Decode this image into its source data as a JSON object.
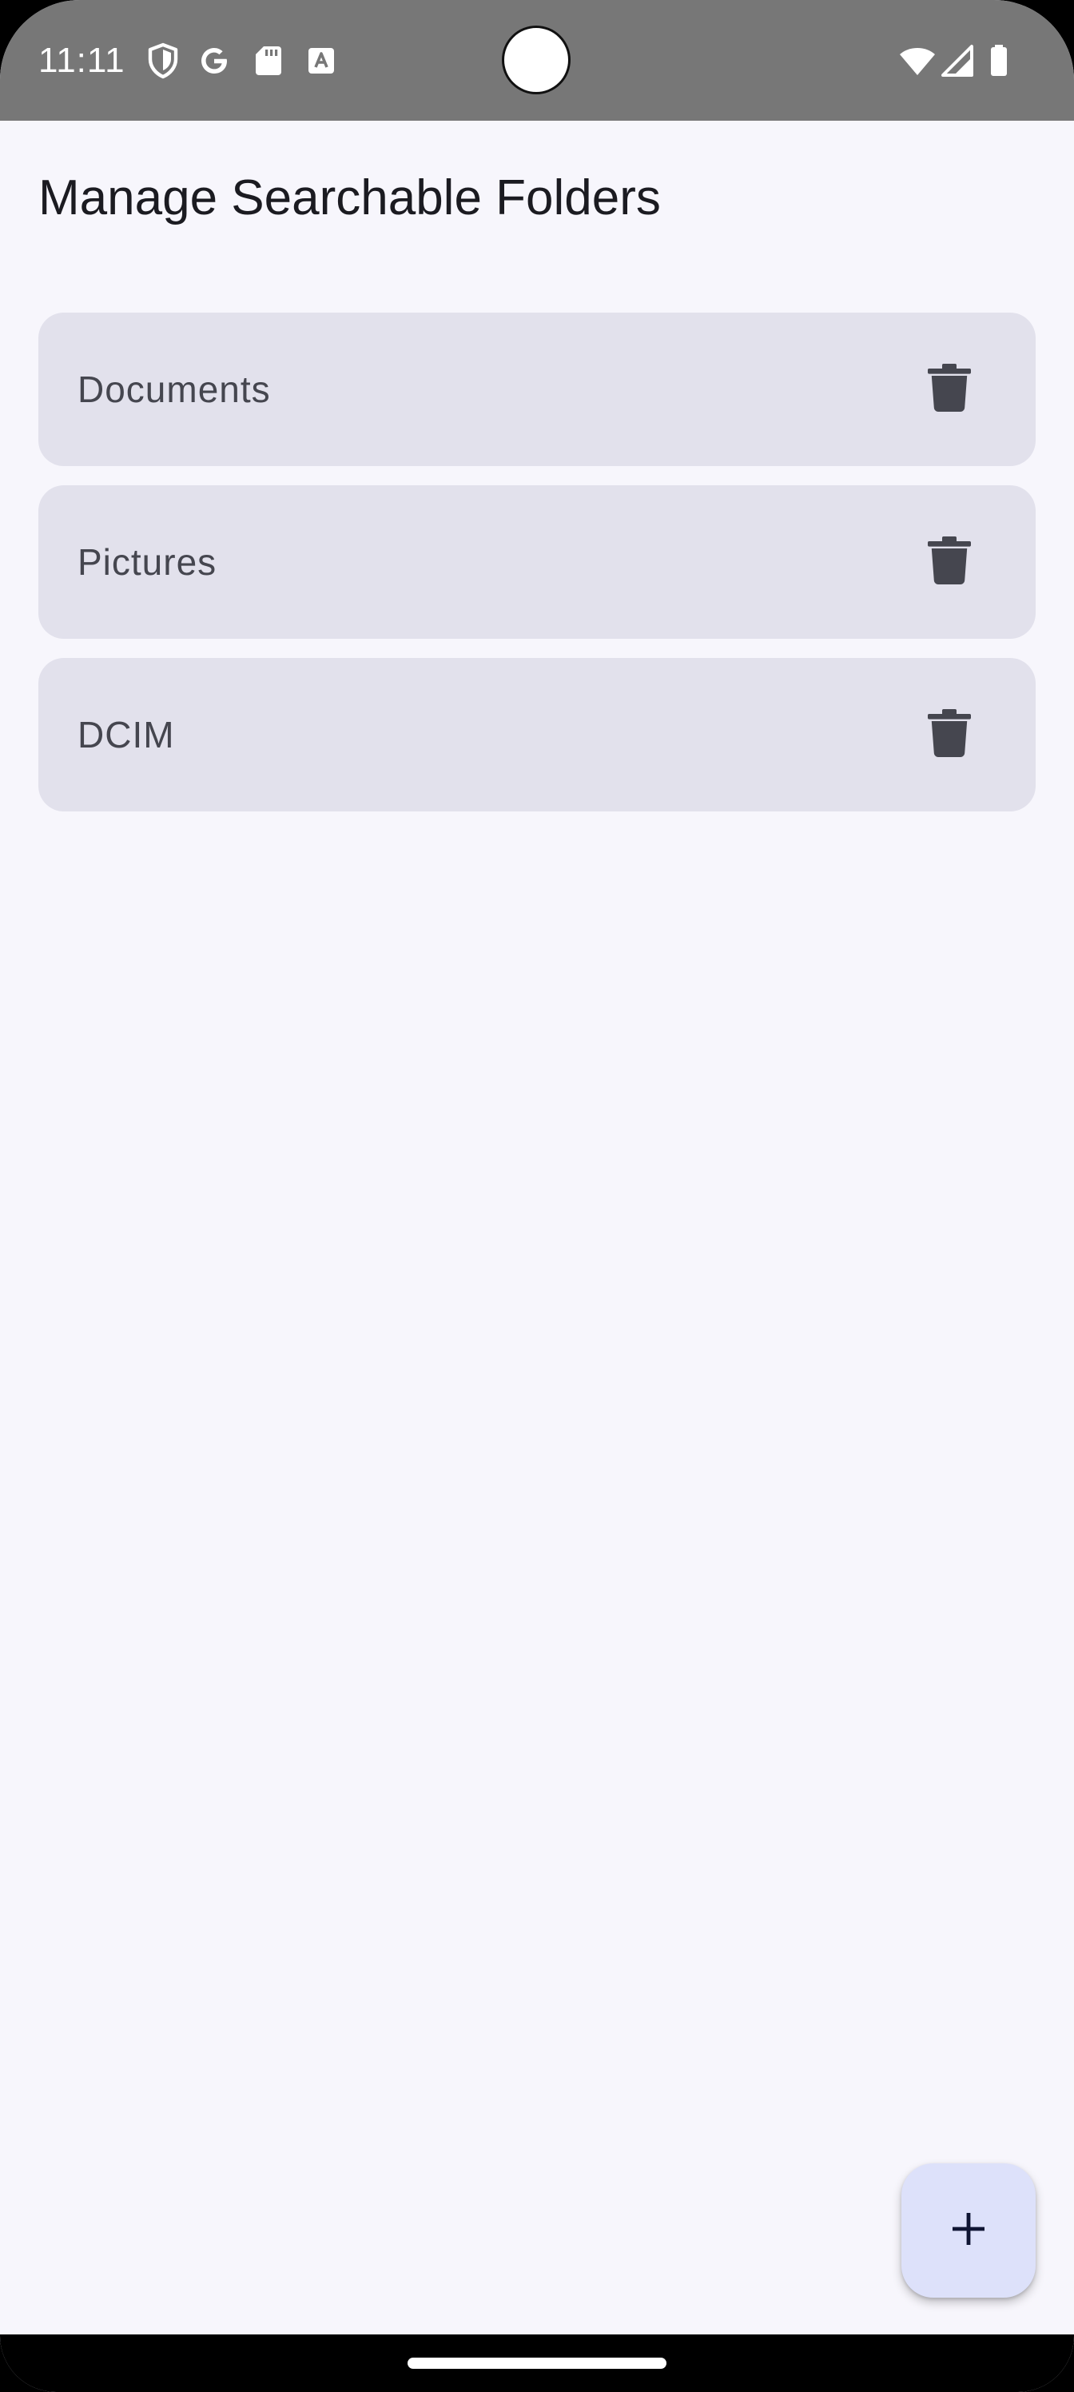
{
  "status_bar": {
    "time": "11:11",
    "icons": [
      "shield-icon",
      "google-icon",
      "sd-card-icon",
      "text-a-icon"
    ],
    "right_icons": [
      "wifi-icon",
      "cellular-signal-icon",
      "battery-icon"
    ]
  },
  "page": {
    "title": "Manage Searchable Folders"
  },
  "folders": [
    {
      "name": "Documents",
      "action_icon": "trash-icon"
    },
    {
      "name": "Pictures",
      "action_icon": "trash-icon"
    },
    {
      "name": "DCIM",
      "action_icon": "trash-icon"
    }
  ],
  "fab": {
    "icon": "plus-icon"
  },
  "colors": {
    "background": "#f7f6fc",
    "status_bar": "#777777",
    "card": "#e2e1ec",
    "card_text": "#45464f",
    "title_text": "#1b1b21",
    "fab_background": "#dde1fa",
    "fab_icon": "#0f1533"
  }
}
